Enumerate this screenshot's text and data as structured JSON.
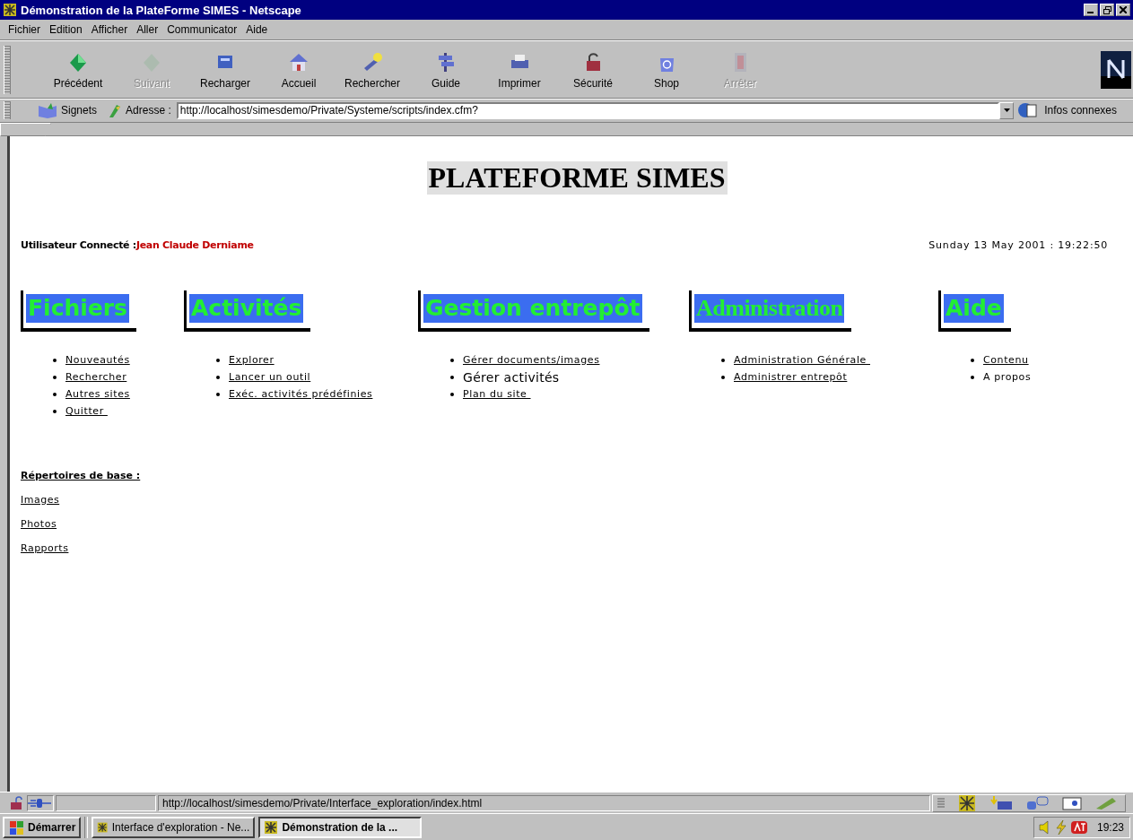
{
  "window": {
    "title": "Démonstration de la PlateForme SIMES - Netscape"
  },
  "menu": [
    "Fichier",
    "Edition",
    "Afficher",
    "Aller",
    "Communicator",
    "Aide"
  ],
  "toolbar": {
    "buttons": [
      {
        "label": "Précédent",
        "disabled": false
      },
      {
        "label": "Suivant",
        "disabled": true
      },
      {
        "label": "Recharger",
        "disabled": false
      },
      {
        "label": "Accueil",
        "disabled": false
      },
      {
        "label": "Rechercher",
        "disabled": false
      },
      {
        "label": "Guide",
        "disabled": false
      },
      {
        "label": "Imprimer",
        "disabled": false
      },
      {
        "label": "Sécurité",
        "disabled": false
      },
      {
        "label": "Shop",
        "disabled": false
      },
      {
        "label": "Arrêter",
        "disabled": true
      }
    ]
  },
  "location": {
    "bookmarks": "Signets",
    "address_label": "Adresse :",
    "url": "http://localhost/simesdemo/Private/Systeme/scripts/index.cfm?",
    "related": "Infos connexes"
  },
  "page": {
    "heading": "PLATEFORME SIMES",
    "user_label": "Utilisateur Connecté :",
    "user_name": "Jean Claude Derniame",
    "datetime": "Sunday 13 May 2001 : 19:22:50",
    "sections": [
      {
        "title": "Fichiers",
        "kind": "sans",
        "items": [
          {
            "label": "Nouveautés",
            "kind": "link"
          },
          {
            "label": "Rechercher",
            "kind": "link"
          },
          {
            "label": "Autres sites",
            "kind": "link"
          },
          {
            "label": "Quitter ",
            "kind": "link"
          }
        ]
      },
      {
        "title": "Activités",
        "kind": "sans",
        "items": [
          {
            "label": "Explorer",
            "kind": "link"
          },
          {
            "label": "Lancer un outil",
            "kind": "link"
          },
          {
            "label": "Exéc. activités prédéfinies",
            "kind": "link"
          }
        ]
      },
      {
        "title": "Gestion entrepôt",
        "kind": "sans",
        "items": [
          {
            "label": "Gérer documents/images",
            "kind": "link"
          },
          {
            "label": "Gérer activités",
            "kind": "large"
          },
          {
            "label": "Plan du site ",
            "kind": "link"
          }
        ]
      },
      {
        "title": "Administration",
        "kind": "serif",
        "items": [
          {
            "label": "Administration Générale ",
            "kind": "link"
          },
          {
            "label": "Administrer entrepôt",
            "kind": "link"
          }
        ]
      },
      {
        "title": "Aide",
        "kind": "sans",
        "items": [
          {
            "label": "Contenu",
            "kind": "link"
          },
          {
            "label": "A propos",
            "kind": "text"
          }
        ]
      }
    ],
    "directories": {
      "title": "Répertoires de base :",
      "links": [
        "Images",
        "Photos",
        "Rapports"
      ]
    }
  },
  "status_bar": {
    "url": "http://localhost/simesdemo/Private/Interface_exploration/index.html"
  },
  "taskbar": {
    "start": "Démarrer",
    "tasks": [
      {
        "label": "Interface d'exploration - Ne...",
        "selected": false
      },
      {
        "label": "Démonstration de la ...",
        "selected": true
      }
    ],
    "clock": "19:23"
  }
}
